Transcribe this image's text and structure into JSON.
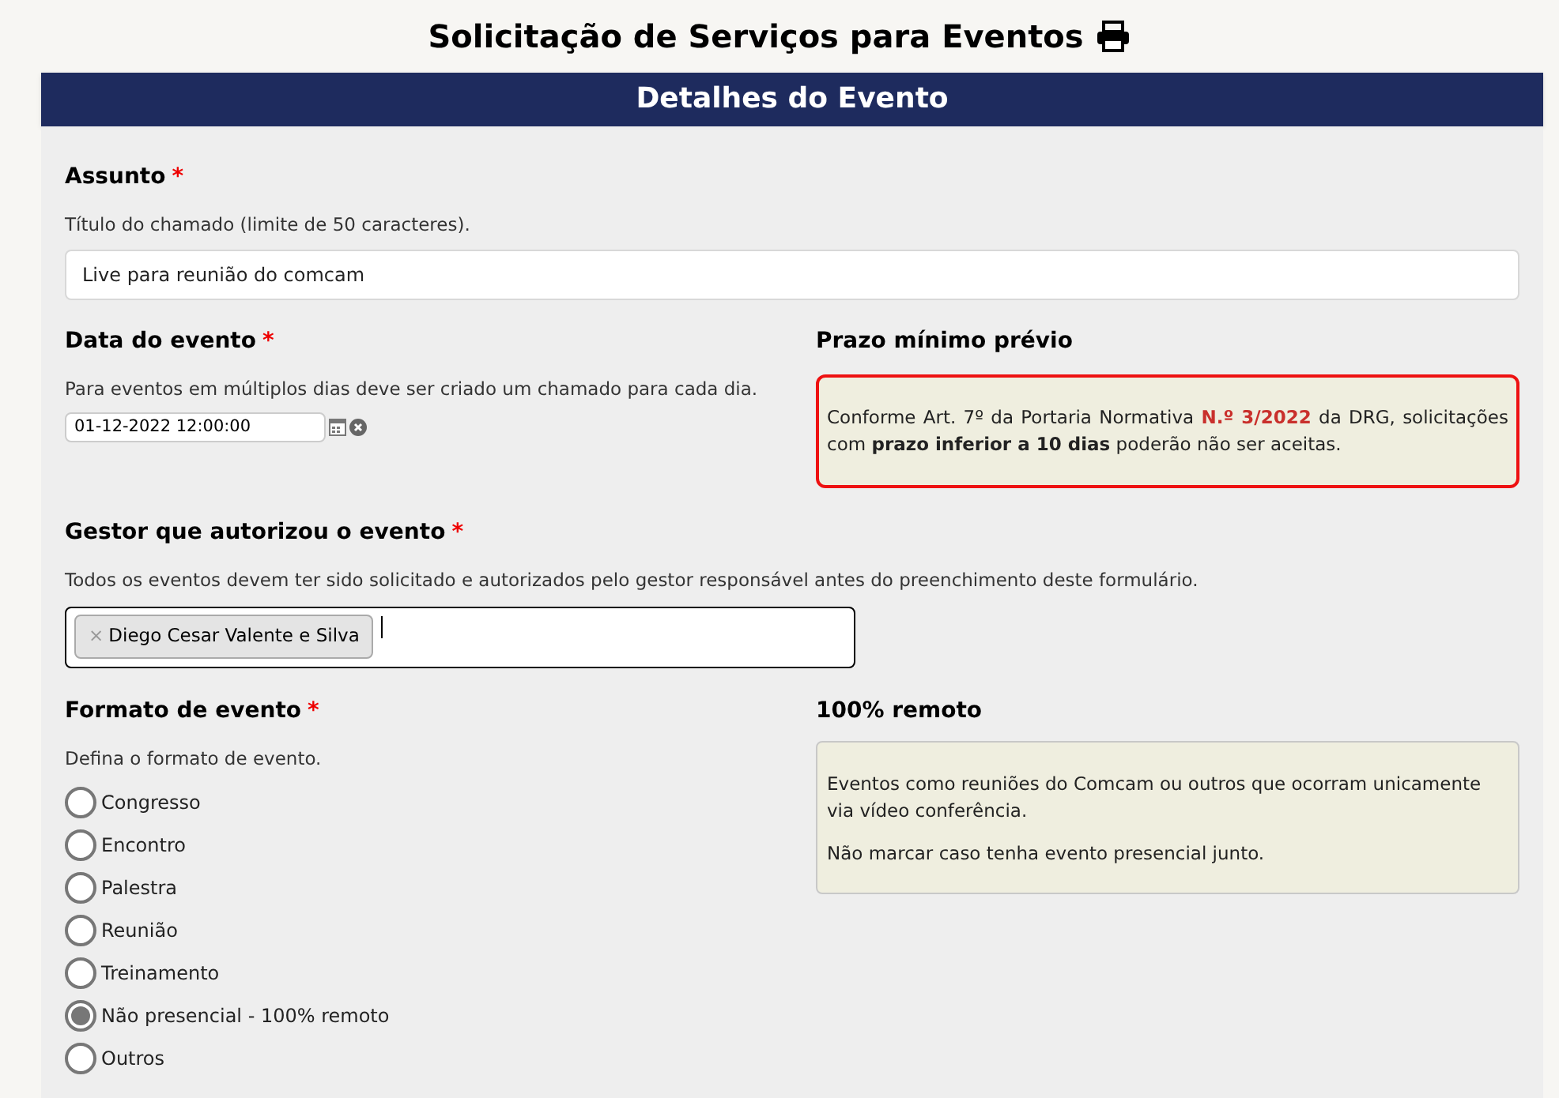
{
  "page_title": "Solicitação de Serviços para Eventos",
  "section_header": "Detalhes do Evento",
  "subject": {
    "label": "Assunto",
    "required_mark": "*",
    "help": "Título do chamado (limite de 50 caracteres).",
    "value": "Live para reunião do comcam"
  },
  "event_date": {
    "label": "Data do evento",
    "required_mark": "*",
    "help": "Para eventos em múltiplos dias deve ser criado um chamado para cada dia.",
    "value": "01-12-2022 12:00:00"
  },
  "deadline_notice": {
    "title": "Prazo mínimo prévio",
    "text_before": "Conforme Art. 7º da Portaria Normativa",
    "reference": "N.º 3/2022",
    "text_after": "da DRG, solicitações com **prazo inferior a 10 dias** poderão não ser aceitas."
  },
  "manager": {
    "label": "Gestor que autorizou o evento",
    "required_mark": "*",
    "help": "Todos os eventos devem ter sido solicitado e autorizados pelo gestor responsável antes do preenchimento deste formulário.",
    "tags": [
      {
        "remove": "×",
        "name": "Diego Cesar Valente e Silva"
      }
    ]
  },
  "format": {
    "label": "Formato de evento",
    "required_mark": "*",
    "help": "Defina o formato de evento.",
    "options": [
      {
        "label": "Congresso",
        "selected": false
      },
      {
        "label": "Encontro",
        "selected": false
      },
      {
        "label": "Palestra",
        "selected": false
      },
      {
        "label": "Reunião",
        "selected": false
      },
      {
        "label": "Treinamento",
        "selected": false
      },
      {
        "label": "Não presencial - 100% remoto",
        "selected": true
      },
      {
        "label": "Outros",
        "selected": false
      }
    ]
  },
  "remote_notice": {
    "title": "100% remoto",
    "paragraphs": [
      "Eventos como reuniões do Comcam ou outros que ocorram unicamente via vídeo conferência.",
      "Não marcar caso tenha evento presencial junto."
    ]
  }
}
